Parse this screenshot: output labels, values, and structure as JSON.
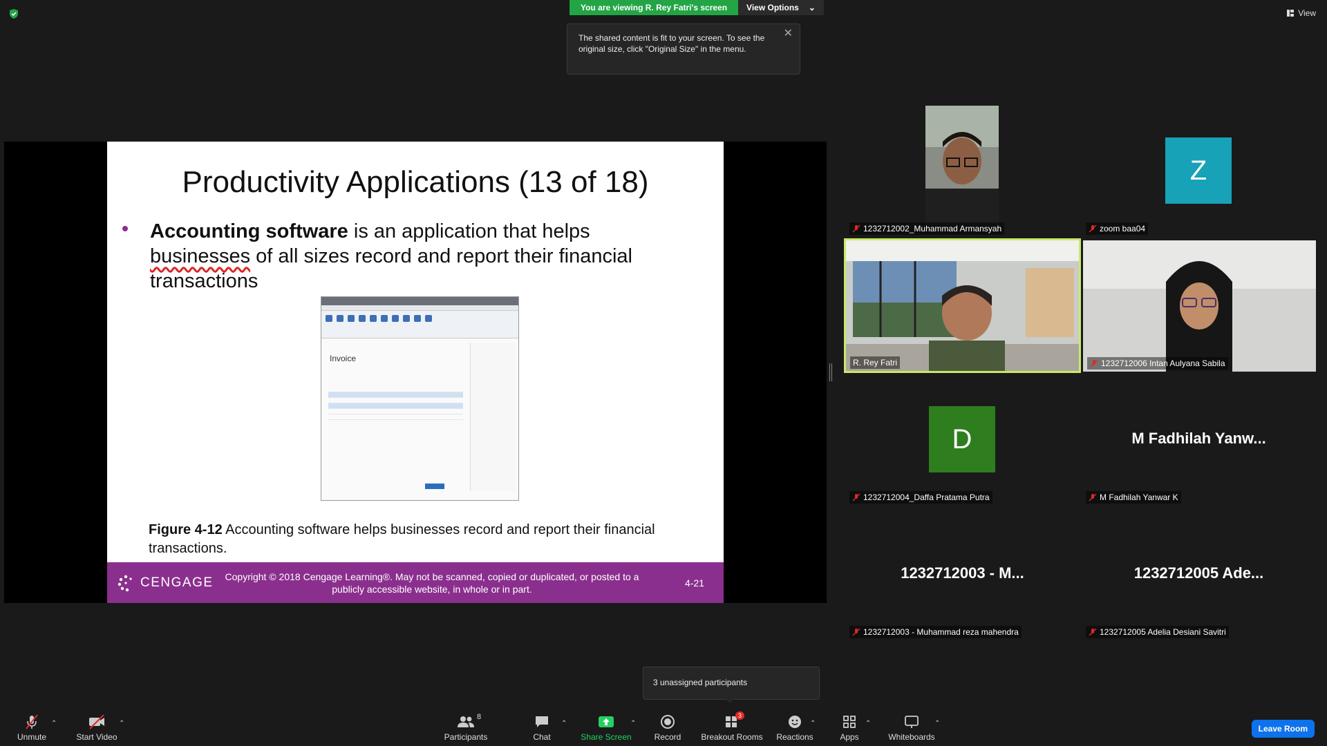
{
  "banner": {
    "viewing_text": "You are viewing R. Rey Fatri's screen",
    "view_options_label": "View Options"
  },
  "top_right": {
    "view_label": "View"
  },
  "tooltip": {
    "text": "The shared content is fit to your screen. To see the original size, click \"Original Size\" in the menu."
  },
  "slide": {
    "title": "Productivity Applications (13 of 18)",
    "bullet_bold": "Accounting software",
    "bullet_rest_1": " is an application that helps ",
    "bullet_word_underlined": "businesses",
    "bullet_rest_2": " of all sizes record and report their financial transactions",
    "figure_inner_title": "Invoice",
    "figure_caption_bold": "Figure 4-12",
    "figure_caption_rest": " Accounting software helps businesses record and report their financial transactions.",
    "logo_text": "CENGAGE",
    "copyright": "Copyright © 2018 Cengage Learning®. May not be scanned, copied or duplicated, or posted to a publicly accessible website, in whole or in part.",
    "page_number": "4-21"
  },
  "participants_tiles": [
    {
      "name": "1232712002_Muhammad Armansyah",
      "type": "video"
    },
    {
      "name": "zoom baa04",
      "type": "avatar",
      "initial": "Z",
      "color": "#17a2b8"
    },
    {
      "name": "R. Rey Fatri",
      "type": "video",
      "active": true
    },
    {
      "name": "1232712006 Intan Aulyana Sabila",
      "type": "video"
    },
    {
      "name": "1232712004_Daffa Pratama Putra",
      "type": "avatar",
      "initial": "D",
      "color": "#2e7d1e"
    },
    {
      "name": "M Fadhilah Yanwar K",
      "type": "name",
      "display": "M Fadhilah Yanw..."
    },
    {
      "name": "1232712003 - Muhammad reza mahendra",
      "type": "name",
      "display": "1232712003 - M..."
    },
    {
      "name": "1232712005 Adelia Desiani Savitri",
      "type": "name",
      "display": "1232712005 Ade..."
    }
  ],
  "unassigned": {
    "text": "3 unassigned participants"
  },
  "toolbar": {
    "unmute": "Unmute",
    "start_video": "Start Video",
    "participants": "Participants",
    "participants_count": "8",
    "chat": "Chat",
    "share_screen": "Share Screen",
    "record": "Record",
    "breakout_rooms": "Breakout Rooms",
    "breakout_badge": "3",
    "reactions": "Reactions",
    "apps": "Apps",
    "whiteboards": "Whiteboards",
    "leave": "Leave Room"
  }
}
